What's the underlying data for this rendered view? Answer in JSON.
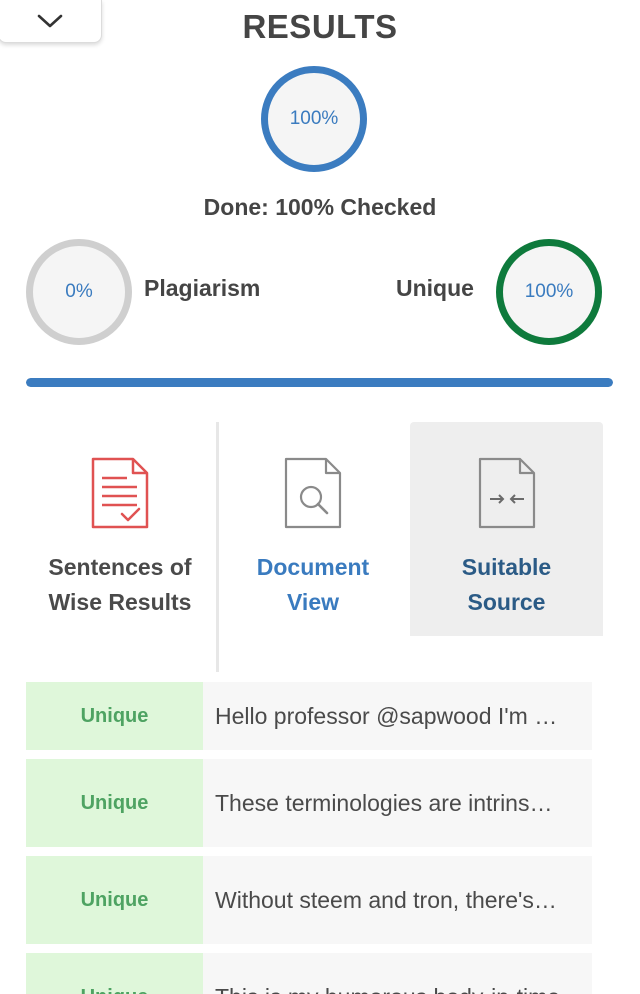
{
  "header": {
    "title": "RESULTS"
  },
  "summary": {
    "overall_percent": "100%",
    "done_text": "Done: 100% Checked",
    "progress_fraction": 1.0
  },
  "plagiarism": {
    "label": "Plagiarism",
    "percent": "0%"
  },
  "unique": {
    "label": "Unique",
    "percent": "100%"
  },
  "tabs": [
    {
      "label": "Sentences of Wise Results",
      "icon": "report-document-icon"
    },
    {
      "label": "Document View",
      "icon": "document-search-icon"
    },
    {
      "label": "Suitable Source",
      "icon": "document-compare-icon"
    }
  ],
  "rows": [
    {
      "status": "Unique",
      "text": "Hello professor @sapwood I'm …"
    },
    {
      "status": "Unique",
      "text": "These terminologies are intrins…"
    },
    {
      "status": "Unique",
      "text": "Without steem and tron, there's…"
    },
    {
      "status": "Unique",
      "text": "This is my humorous body-in-time…"
    }
  ],
  "colors": {
    "accent_blue": "#3b7cc0",
    "unique_green": "#0e7a3c",
    "plagiarism_gray": "#cfcfcf",
    "status_bg": "#dff7da",
    "status_text": "#4ea362",
    "report_icon_red": "#e05252"
  }
}
